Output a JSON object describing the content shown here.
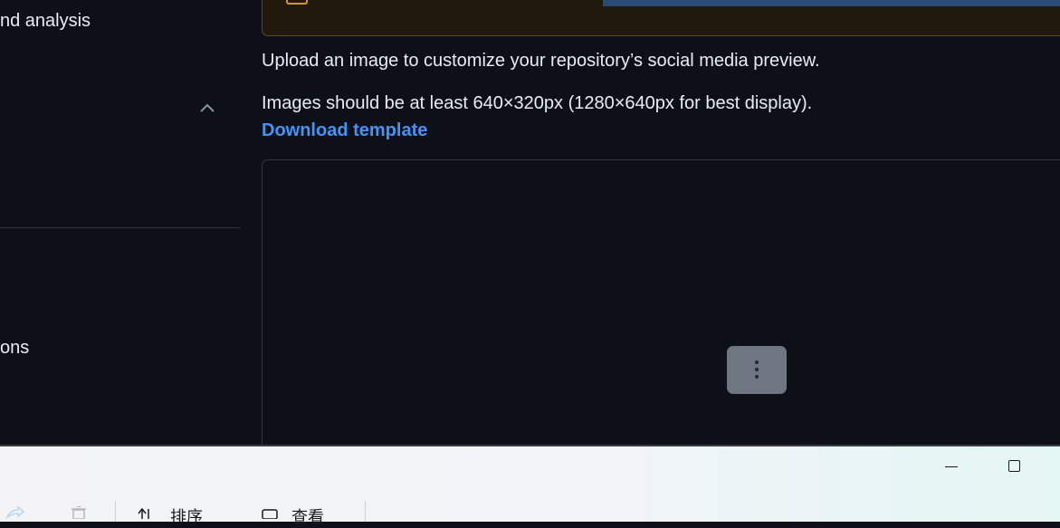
{
  "sidebar": {
    "item_analysis": "nd analysis",
    "item_ons": "ons"
  },
  "main": {
    "upload_text": "Upload an image to customize your repository’s social media preview.",
    "size_text": "Images should be at least 640×320px (1280×640px for best display).",
    "download_link": "Download template"
  },
  "toolbar": {
    "sort_label": "排序",
    "view_label": "查看"
  },
  "colors": {
    "background": "#0d1117",
    "link": "#4493f8",
    "warning_border": "#d29922"
  }
}
